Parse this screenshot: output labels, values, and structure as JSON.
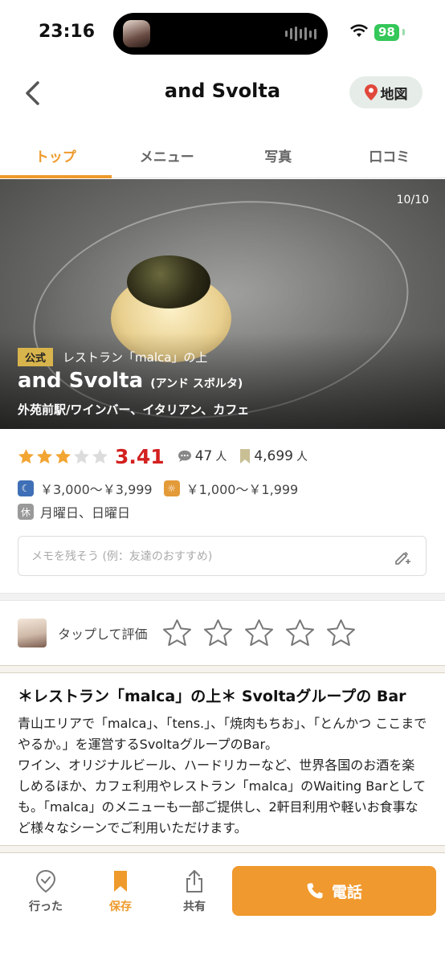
{
  "status_bar": {
    "time": "23:16",
    "battery": "98"
  },
  "nav": {
    "title": "and Svolta",
    "map_label": "地図"
  },
  "tabs": [
    {
      "label": "トップ",
      "active": true
    },
    {
      "label": "メニュー",
      "active": false
    },
    {
      "label": "写真",
      "active": false
    },
    {
      "label": "口コミ",
      "active": false
    }
  ],
  "hero": {
    "counter": "10/10",
    "badge": "公式",
    "location_note": "レストラン「malca」の上",
    "name": "and Svolta",
    "name_kana": "(アンド スボルタ)",
    "genre": "外苑前駅/ワインバー、イタリアン、カフェ"
  },
  "rating": {
    "stars_filled": 3,
    "stars_total": 5,
    "score": "3.41",
    "reviews_count": "47",
    "reviews_unit": "人",
    "saves_count": "4,699",
    "saves_unit": "人"
  },
  "price": {
    "dinner": "￥3,000～￥3,999",
    "lunch": "￥1,000～￥1,999",
    "holiday_badge": "休",
    "holidays": "月曜日、日曜日"
  },
  "memo": {
    "placeholder": "メモを残そう (例：友達のおすすめ)"
  },
  "rate_prompt": {
    "label": "タップして評価"
  },
  "pr": {
    "title": "＊レストラン「malca」の上＊ Svoltaグループの Bar",
    "body": "青山エリアで「malca」、「tens.」、「焼肉もちお」、「とんかつ ここまでやるか。」を運営するSvoltaグループのBar。\nワイン、オリジナルビール、ハードリカーなど、世界各国のお酒を楽しめるほか、カフェ利用やレストラン「malca」のWaiting Barとしても。「malca」のメニューも一部ご提供し、2軒目利用や軽いお食事など様々なシーンでご利用いただけます。"
  },
  "bottom_bar": {
    "went": "行った",
    "save": "保存",
    "share": "共有",
    "call": "電話"
  },
  "colors": {
    "accent": "#ee9a2c",
    "score": "#d32020",
    "badge": "#d8b44c"
  }
}
